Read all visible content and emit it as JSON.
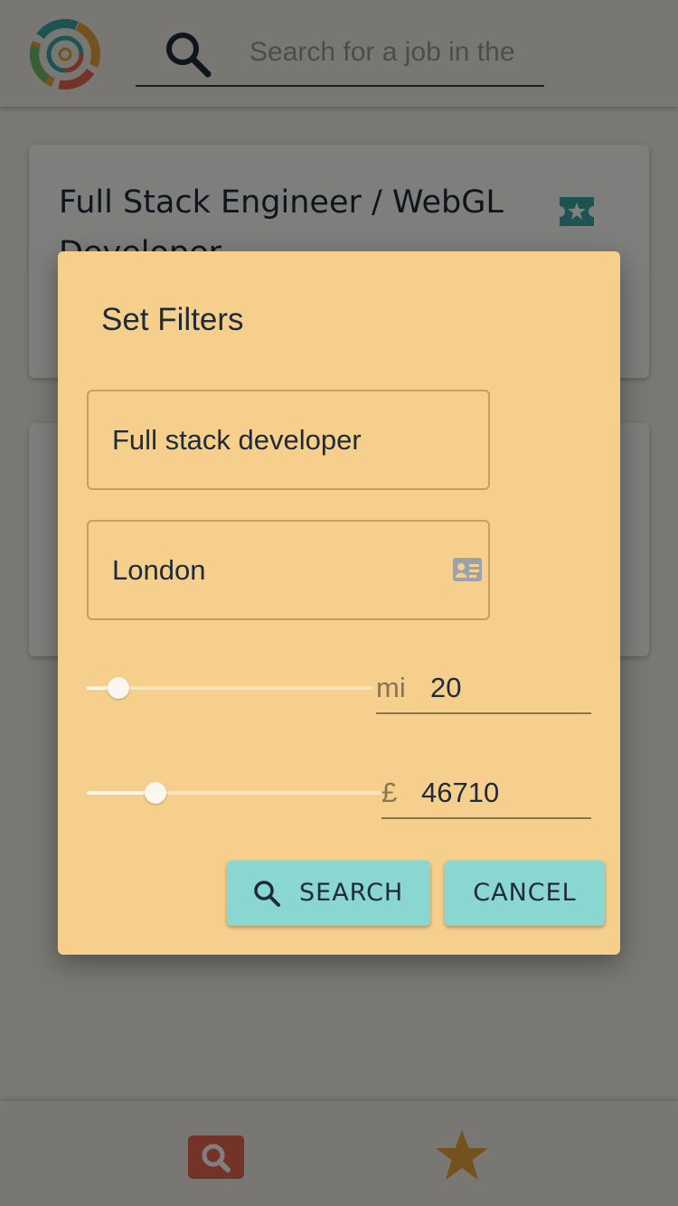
{
  "header": {
    "logo": "concentric-target-logo",
    "search_placeholder": "Search for a job in the"
  },
  "results": [
    {
      "title": "Full Stack Engineer / WebGL Developer",
      "favorite_icon": "star-ticket-icon"
    },
    {
      "title": ""
    }
  ],
  "bottom_nav": {
    "items": [
      {
        "icon": "search-icon",
        "color": "#e8674f"
      },
      {
        "icon": "star-icon",
        "color": "#e8a53a"
      }
    ]
  },
  "dialog": {
    "title": "Set Filters",
    "keyword_value": "Full stack developer",
    "location_value": "London",
    "location_icon": "contact-card-icon",
    "distance": {
      "unit": "mi",
      "value": "20",
      "slider_fraction": 0.11
    },
    "salary": {
      "unit": "£",
      "value": "46710",
      "slider_fraction": 0.234
    },
    "search_button": "SEARCH",
    "cancel_button": "CANCEL"
  },
  "colors": {
    "dialog_bg": "#f5cf8b",
    "button_bg": "#8ad6d1",
    "accent_teal": "#3aa8a2",
    "text_dark": "#1f2b38"
  }
}
